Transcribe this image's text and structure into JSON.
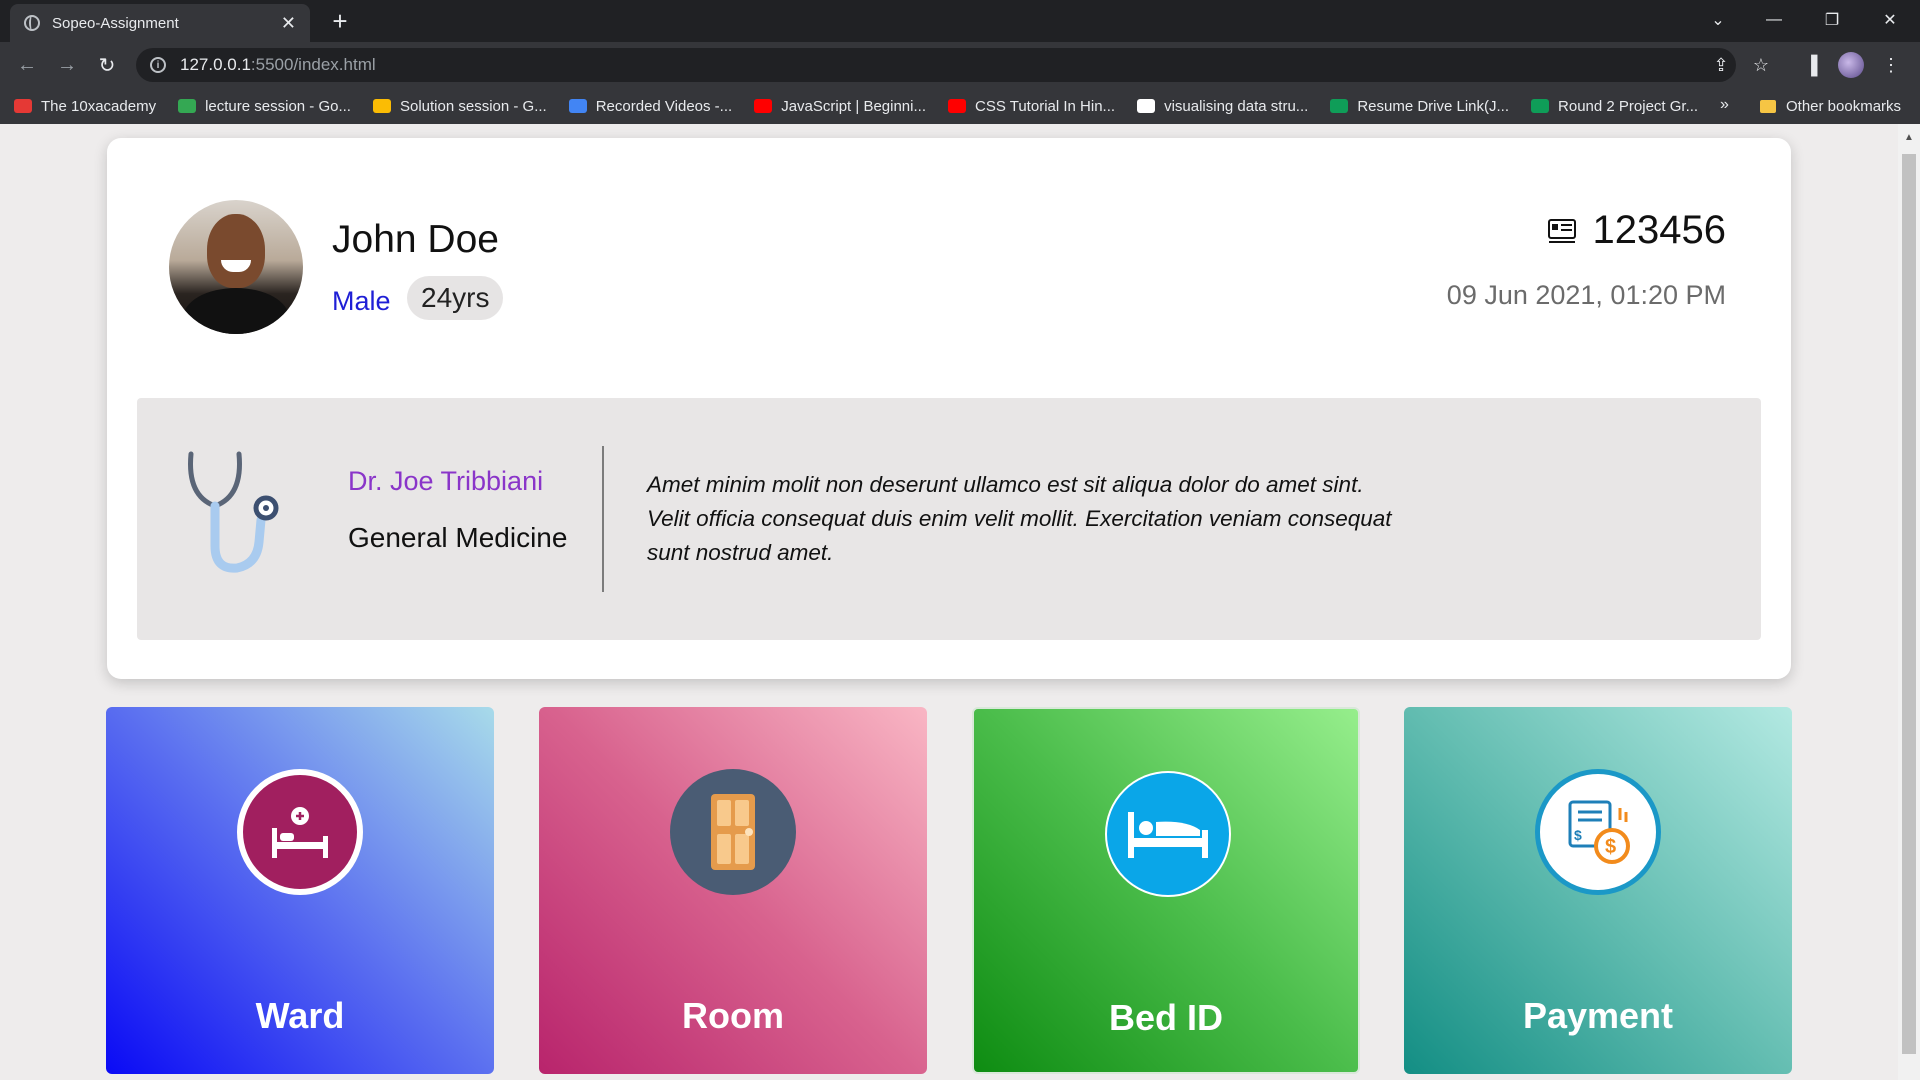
{
  "browser": {
    "tab_title": "Sopeo-Assignment",
    "tab_close": "✕",
    "new_tab": "+",
    "url_host": "127.0.0.1",
    "url_path": ":5500/index.html",
    "bookmarks": [
      {
        "label": "The 10xacademy",
        "color": "#e53935"
      },
      {
        "label": "lecture session - Go...",
        "color": "#34a853"
      },
      {
        "label": "Solution session - G...",
        "color": "#fbbc04"
      },
      {
        "label": "Recorded Videos -...",
        "color": "#4285f4"
      },
      {
        "label": "JavaScript | Beginni...",
        "color": "#ff0000"
      },
      {
        "label": "CSS Tutorial In Hin...",
        "color": "#ff0000"
      },
      {
        "label": "visualising data stru...",
        "color": "#ffffff"
      },
      {
        "label": "Resume Drive Link(J...",
        "color": "#0f9d58"
      },
      {
        "label": "Round 2 Project Gr...",
        "color": "#0f9d58"
      }
    ],
    "more_bookmarks": "»",
    "other_bookmarks": "Other bookmarks"
  },
  "patient": {
    "name": "John Doe",
    "gender": "Male",
    "age": "24yrs",
    "id": "123456",
    "datetime": "09 Jun 2021, 01:20 PM"
  },
  "doctor": {
    "name": "Dr. Joe Tribbiani",
    "specialty": "General Medicine",
    "notes": "Amet minim molit non deserunt ullamco est sit aliqua dolor do amet sint. Velit officia consequat duis enim velit mollit. Exercitation veniam consequat sunt nostrud amet."
  },
  "tiles": {
    "ward": "Ward",
    "room": "Room",
    "bed": "Bed ID",
    "payment": "Payment"
  },
  "icons": {
    "patient_id": "id-card-icon",
    "doctor": "stethoscope-icon",
    "ward": "hospital-bed-icon",
    "room": "door-icon",
    "bed": "bed-icon",
    "payment": "payment-icon"
  }
}
